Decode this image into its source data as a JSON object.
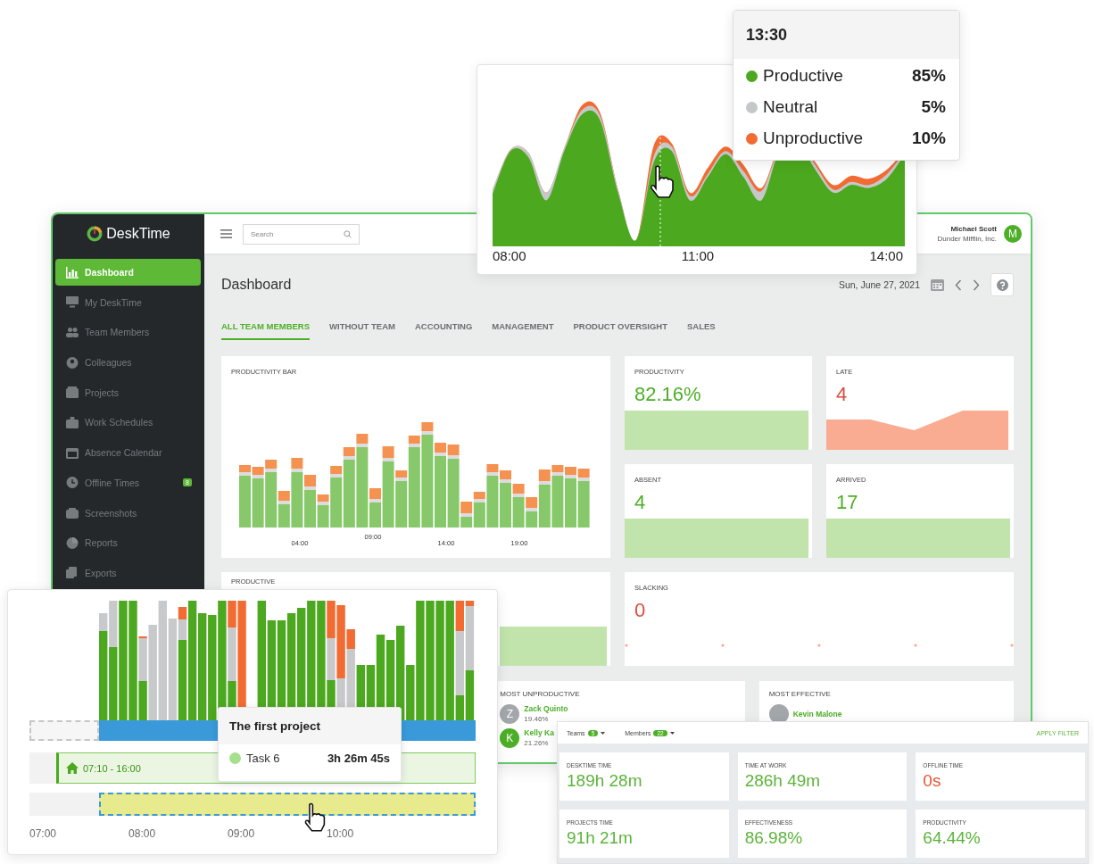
{
  "dashboard_window": {
    "logo": "DeskTime",
    "sidebar": {
      "items": [
        {
          "label": "Dashboard",
          "selected": true
        },
        {
          "label": "My DeskTime",
          "selected": false
        },
        {
          "label": "Team Members",
          "selected": false
        },
        {
          "label": "Colleagues",
          "selected": false
        },
        {
          "label": "Projects",
          "selected": false
        },
        {
          "label": "Work Schedules",
          "selected": false
        },
        {
          "label": "Absence Calendar",
          "selected": false
        },
        {
          "label": "Offline Times",
          "selected": false,
          "badge": "8"
        },
        {
          "label": "Screenshots",
          "selected": false
        },
        {
          "label": "Reports",
          "selected": false
        },
        {
          "label": "Exports",
          "selected": false
        }
      ]
    },
    "header": {
      "search_placeholder": "Search",
      "user_name": "Michael Scott",
      "company": "Dunder Mifflin, Inc.",
      "avatar_initial": "M"
    },
    "page_title": "Dashboard",
    "date": "Sun, June 27, 2021",
    "tabs": [
      {
        "label": "ALL TEAM MEMBERS",
        "selected": true
      },
      {
        "label": "WITHOUT TEAM",
        "selected": false
      },
      {
        "label": "ACCOUNTING",
        "selected": false
      },
      {
        "label": "MANAGEMENT",
        "selected": false
      },
      {
        "label": "PRODUCT OVERSIGHT",
        "selected": false
      },
      {
        "label": "SALES",
        "selected": false
      }
    ],
    "productivity_bar": {
      "title": "PRODUCTIVITY BAR",
      "time_labels": [
        "04:00",
        "09:00",
        "14:00",
        "19:00"
      ]
    },
    "stat_cards": [
      {
        "label": "PRODUCTIVITY",
        "value": "82.16%",
        "color": "#4caf26",
        "kind": "bar"
      },
      {
        "label": "LATE",
        "value": "4",
        "color": "#dd4b3e",
        "kind": "area"
      },
      {
        "label": "ABSENT",
        "value": "4",
        "color": "#4caf26",
        "kind": "bar"
      },
      {
        "label": "ARRIVED",
        "value": "17",
        "color": "#4caf26",
        "kind": "bar"
      }
    ],
    "productive_card": {
      "label": "PRODUCTIVE"
    },
    "slacking_card": {
      "label": "SLACKING",
      "value": "0",
      "color": "#dd4b3e"
    },
    "most_unproductive": {
      "title": "MOST UNPRODUCTIVE",
      "people": [
        {
          "initial": "Z",
          "name": "Zack Quinto",
          "value": "19.46%",
          "color": "#a3a7ab"
        },
        {
          "initial": "K",
          "name": "Kelly Ka",
          "value": "21.26%",
          "color": "#4caf26"
        }
      ]
    },
    "most_effective": {
      "title": "MOST EFFECTIVE",
      "people": [
        {
          "name": "Kevin Malone",
          "color": "#a3a7ab"
        }
      ]
    }
  },
  "activity_chart": {
    "time_labels": [
      "08:00",
      "11:00",
      "14:00"
    ]
  },
  "activity_tooltip": {
    "time": "13:30",
    "rows": [
      {
        "label": "Productive",
        "value": "85%",
        "color": "#4ca81e"
      },
      {
        "label": "Neutral",
        "value": "5%",
        "color": "#c5c7c9"
      },
      {
        "label": "Unproductive",
        "value": "10%",
        "color": "#f26b32"
      }
    ]
  },
  "timeline": {
    "schedule": "07:10 - 16:00",
    "time_labels": [
      "07:00",
      "08:00",
      "09:00",
      "10:00"
    ],
    "tooltip": {
      "title": "The first project",
      "task": "Task 6",
      "duration": "3h 26m 45s",
      "color": "#a6e08c"
    }
  },
  "stats_panel": {
    "filters": [
      {
        "label": "Teams",
        "count": "5"
      },
      {
        "label": "Members",
        "count": "22"
      }
    ],
    "apply": "APPLY FILTER",
    "tiles": [
      {
        "label": "DESKTIME TIME",
        "value": "189h 28m",
        "color": "#5cb43a"
      },
      {
        "label": "TIME AT WORK",
        "value": "286h 49m",
        "color": "#5cb43a"
      },
      {
        "label": "OFFLINE TIME",
        "value": "0s",
        "color": "#e8532e"
      },
      {
        "label": "PROJECTS TIME",
        "value": "91h 21m",
        "color": "#5cb43a"
      },
      {
        "label": "EFFECTIVENESS",
        "value": "86.98%",
        "color": "#5cb43a"
      },
      {
        "label": "PRODUCTIVITY",
        "value": "64.44%",
        "color": "#5cb43a"
      }
    ]
  }
}
